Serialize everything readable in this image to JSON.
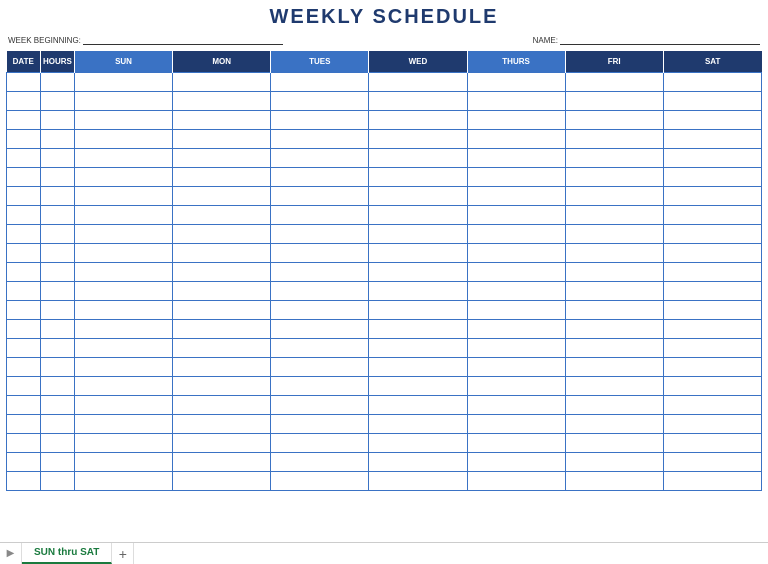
{
  "title": "WEEKLY SCHEDULE",
  "fields": {
    "week_beginning_label": "WEEK BEGINNING:",
    "name_label": "NAME:"
  },
  "columns": {
    "date": "DATE",
    "hours": "HOURS",
    "sun": "SUN",
    "mon": "MON",
    "tues": "TUES",
    "wed": "WED",
    "thurs": "THURS",
    "fri": "FRI",
    "sat": "SAT"
  },
  "row_count": 22,
  "tabs": {
    "active": "SUN thru SAT",
    "nav_symbol": "▶",
    "add_symbol": "+"
  }
}
